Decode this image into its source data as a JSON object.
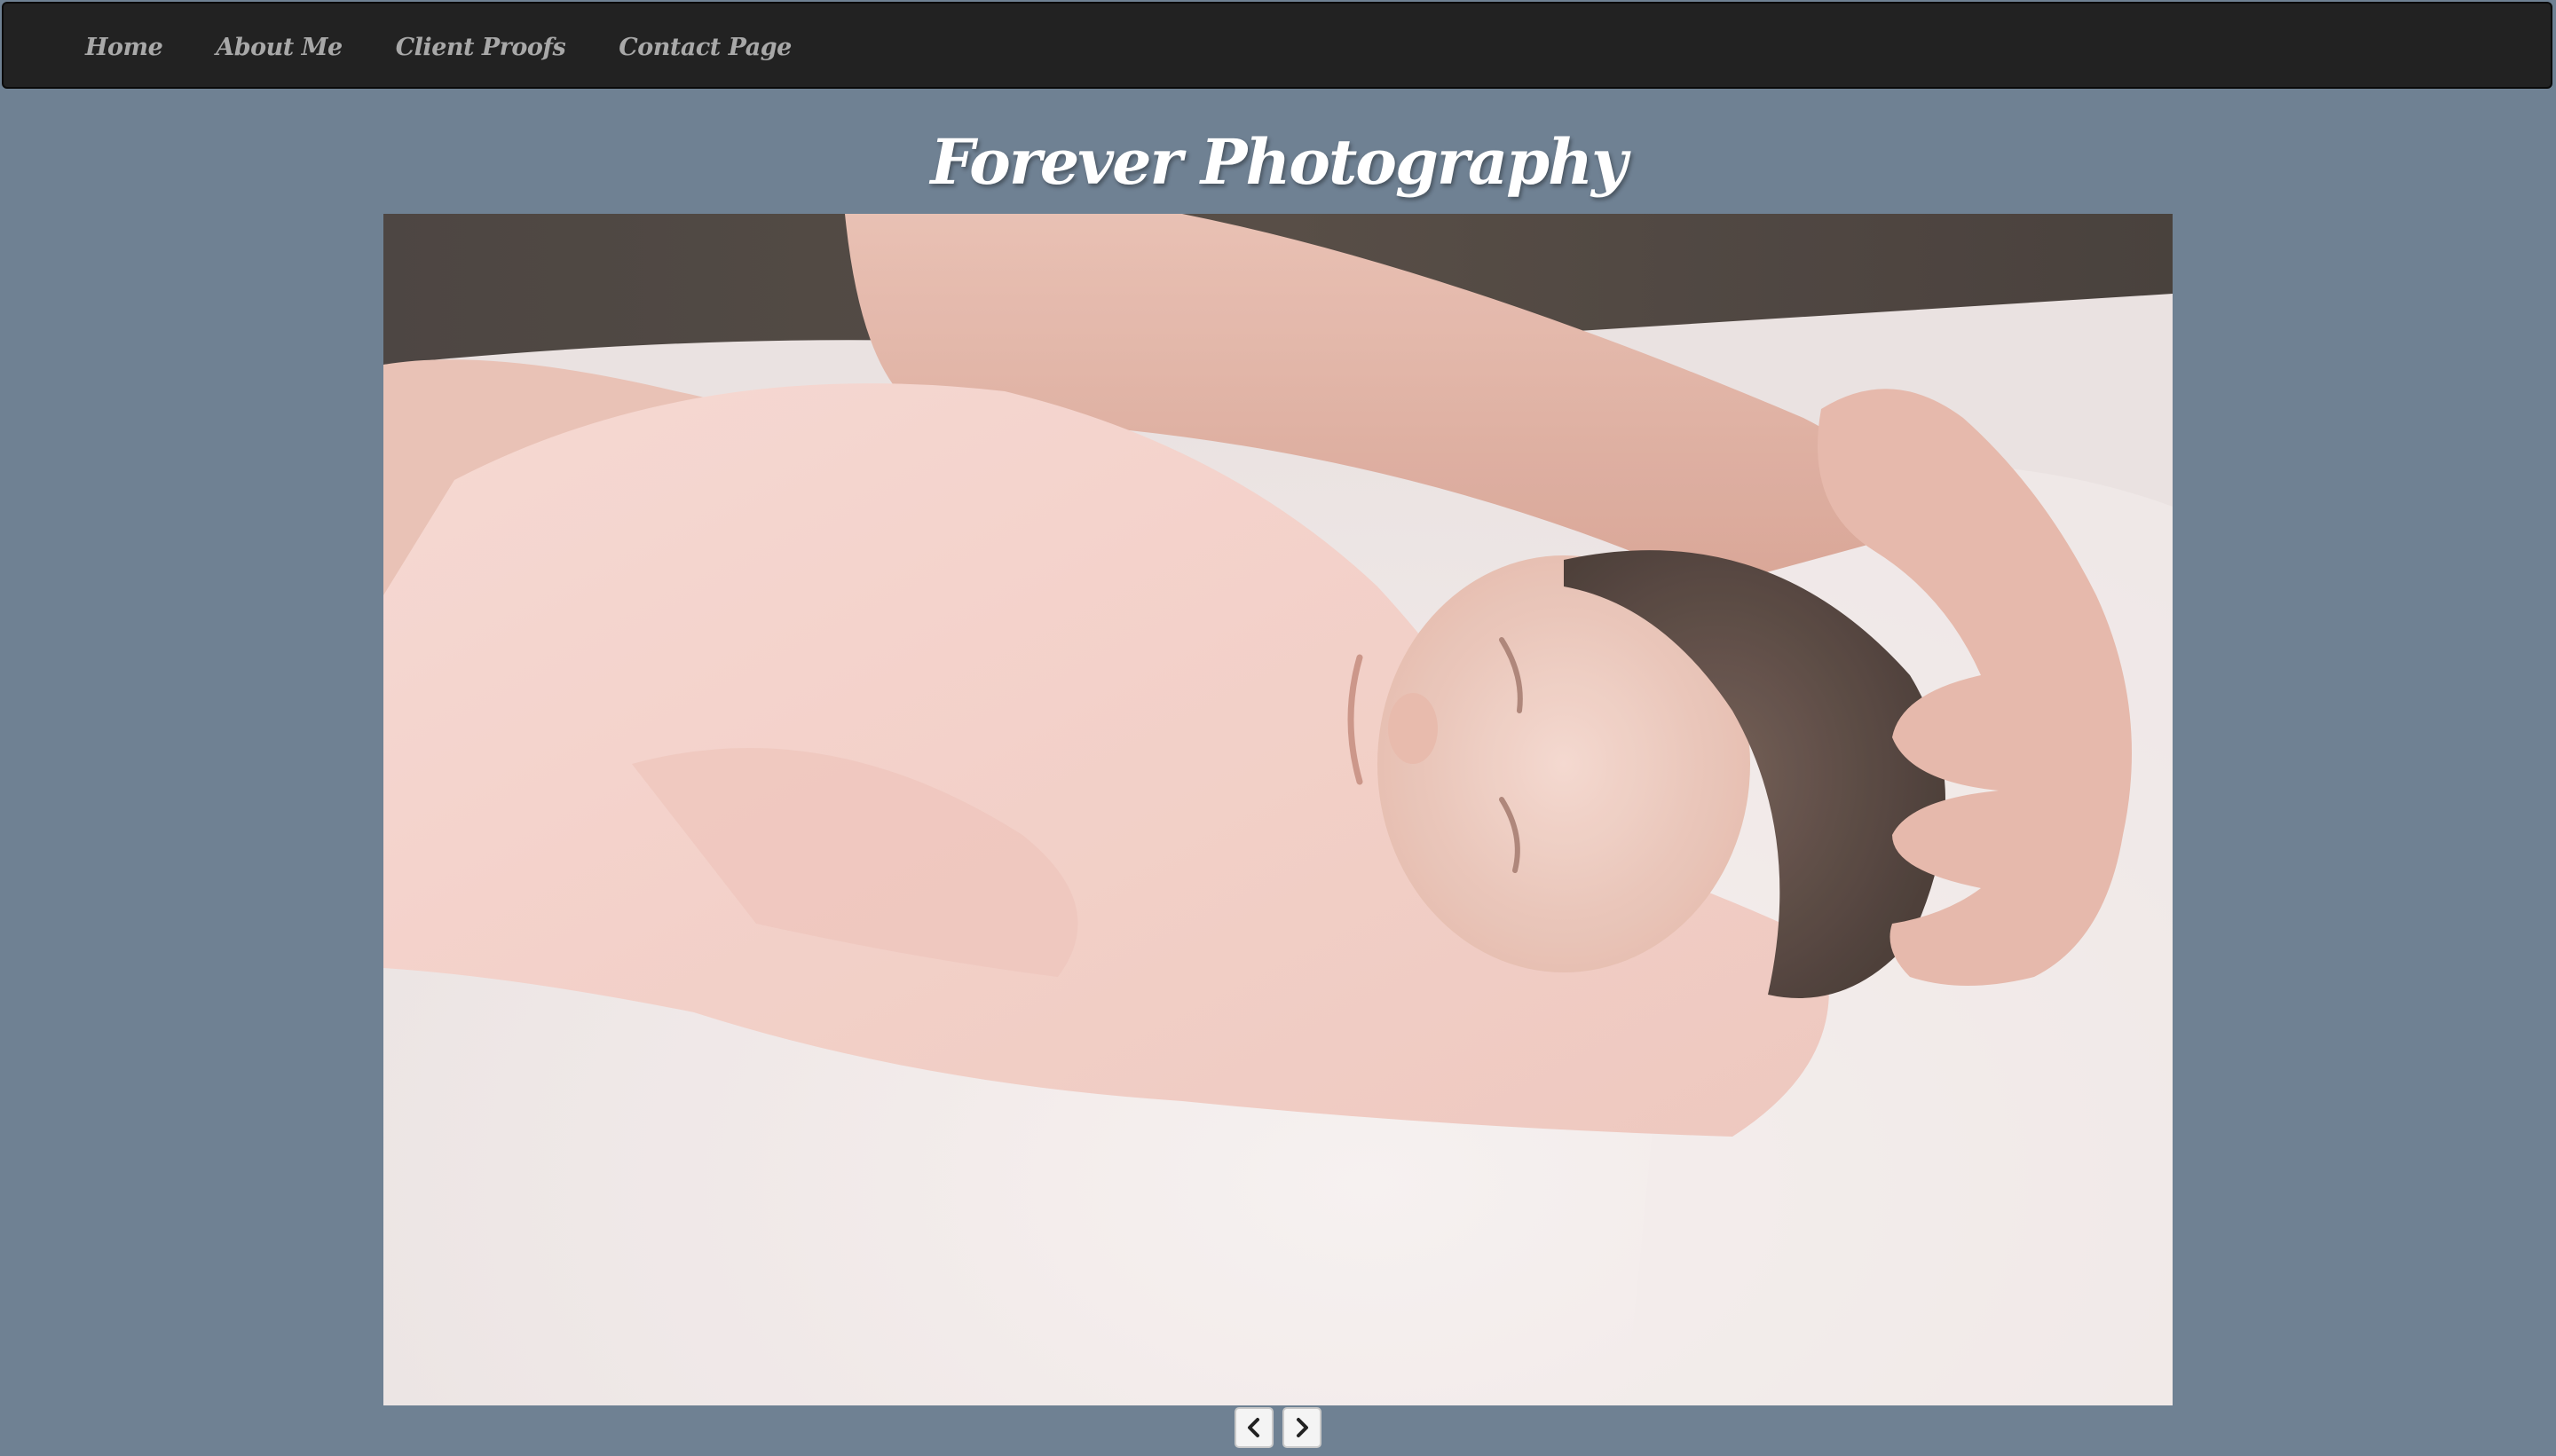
{
  "nav": {
    "items": [
      {
        "label": "Home"
      },
      {
        "label": "About Me"
      },
      {
        "label": "Client Proofs"
      },
      {
        "label": "Contact Page"
      }
    ]
  },
  "header": {
    "title": "Forever Photography"
  },
  "carousel": {
    "prev_icon": "chevron-left-icon",
    "next_icon": "chevron-right-icon"
  },
  "colors": {
    "page_background": "#6f8193",
    "navbar_background": "#222222",
    "nav_text": "#a8a8a8",
    "title_text": "#ffffff"
  }
}
